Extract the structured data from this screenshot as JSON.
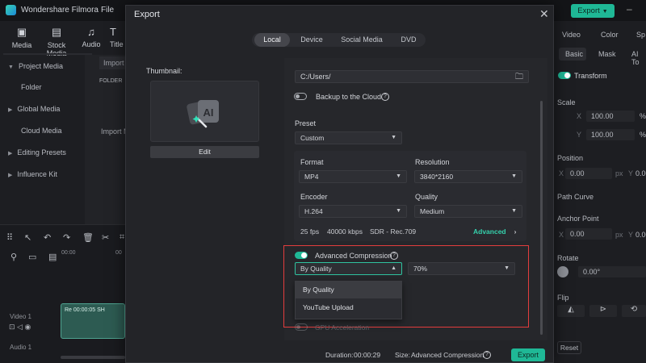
{
  "app": {
    "title": "Wondershare Filmora",
    "menu_file": "File",
    "export_label": "Export"
  },
  "toolbar": {
    "tools": [
      {
        "label": "Media",
        "icon": "media-icon"
      },
      {
        "label": "Stock Media",
        "icon": "stock-media-icon"
      },
      {
        "label": "Audio",
        "icon": "audio-icon"
      },
      {
        "label": "Title",
        "icon": "title-icon"
      }
    ]
  },
  "left_panel": {
    "items": [
      "Project Media",
      "Folder",
      "Global Media",
      "Cloud Media",
      "Editing Presets",
      "Influence Kit"
    ],
    "import_label": "Import",
    "folder_label": "FOLDER",
    "import_media": "Import M"
  },
  "timeline": {
    "ruler_start": "00:00",
    "ruler_next": "00",
    "video_track": "Video 1",
    "audio_track": "Audio 1",
    "clip_label": "Re 00:00:05 SH"
  },
  "right_panel": {
    "tabs": [
      "Video",
      "Color",
      "Sp"
    ],
    "subtabs": [
      "Basic",
      "Mask",
      "AI To"
    ],
    "transform": "Transform",
    "scale": "Scale",
    "x_label": "X",
    "y_label": "Y",
    "scale_x": "100.00",
    "scale_y": "100.00",
    "percent": "%",
    "position": "Position",
    "pos_x": "0.00",
    "pos_y": "0.00",
    "px": "px",
    "path_curve": "Path Curve",
    "anchor_point": "Anchor Point",
    "anchor_x": "0.00",
    "anchor_y": "0.00",
    "rotate": "Rotate",
    "rotate_val": "0.00°",
    "flip": "Flip",
    "reset": "Reset"
  },
  "dialog": {
    "title": "Export",
    "tabs": [
      "Local",
      "Device",
      "Social Media",
      "DVD"
    ],
    "active_tab": "Local",
    "thumbnail_label": "Thumbnail:",
    "edit_label": "Edit",
    "save_path": "C:/Users/",
    "backup_label": "Backup to the Cloud",
    "preset_label": "Preset",
    "preset_value": "Custom",
    "format_label": "Format",
    "format_value": "MP4",
    "resolution_label": "Resolution",
    "resolution_value": "3840*2160",
    "encoder_label": "Encoder",
    "encoder_value": "H.264",
    "quality_label": "Quality",
    "quality_value": "Medium",
    "fps": "25 fps",
    "bitrate": "40000 kbps",
    "color_space": "SDR - Rec.709",
    "advanced_link": "Advanced",
    "adv_compression_label": "Advanced Compression",
    "compression_mode": "By Quality",
    "compression_percent": "70%",
    "dropdown_options": [
      "By Quality",
      "YouTube Upload"
    ],
    "gpu_label": "GPU Acceleration",
    "duration_label": "Duration:",
    "duration_value": "00:00:29",
    "size_label": "Size:",
    "size_value": "Advanced Compression",
    "export_label": "Export"
  },
  "colors": {
    "accent": "#1fb896",
    "highlight": "#e23d3d",
    "bg": "#1b1c20",
    "dialog": "#232428"
  }
}
